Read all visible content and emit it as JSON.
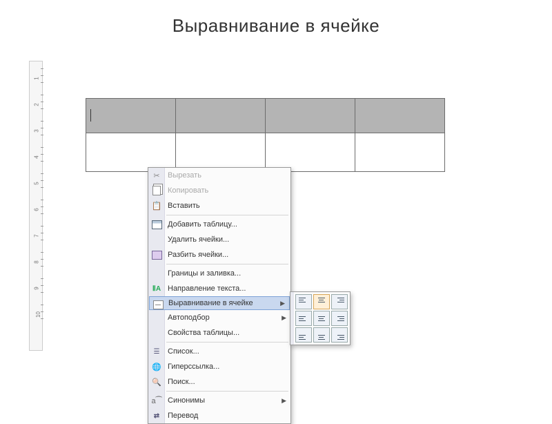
{
  "title": "Выравнивание в ячейке",
  "ruler": {
    "numbers": [
      1,
      2,
      3,
      4,
      5,
      6,
      7,
      8,
      9,
      10
    ]
  },
  "context_menu": {
    "items": [
      {
        "id": "cut",
        "label": "Вырезать",
        "icon": "cut",
        "disabled": true
      },
      {
        "id": "copy",
        "label": "Копировать",
        "icon": "copy",
        "disabled": true
      },
      {
        "id": "paste",
        "label": "Вставить",
        "icon": "paste",
        "disabled": false
      },
      {
        "sep": true
      },
      {
        "id": "insert-tbl",
        "label": "Добавить таблицу...",
        "icon": "addtbl",
        "disabled": false
      },
      {
        "id": "del-cells",
        "label": "Удалить ячейки...",
        "icon": "",
        "disabled": false
      },
      {
        "id": "split",
        "label": "Разбить ячейки...",
        "icon": "split",
        "disabled": false
      },
      {
        "sep": true
      },
      {
        "id": "borders",
        "label": "Границы и заливка...",
        "icon": "",
        "disabled": false
      },
      {
        "id": "text-dir",
        "label": "Направление текста...",
        "icon": "txtdir",
        "disabled": false
      },
      {
        "id": "cell-align",
        "label": "Выравнивание в ячейке",
        "icon": "align",
        "disabled": false,
        "submenu": true,
        "hover": true
      },
      {
        "id": "autofit",
        "label": "Автоподбор",
        "icon": "",
        "disabled": false,
        "submenu": true
      },
      {
        "id": "tbl-props",
        "label": "Свойства таблицы...",
        "icon": "",
        "disabled": false
      },
      {
        "sep": true
      },
      {
        "id": "list",
        "label": "Список...",
        "icon": "list",
        "disabled": false
      },
      {
        "id": "hyperlink",
        "label": "Гиперссылка...",
        "icon": "link",
        "disabled": false
      },
      {
        "id": "find",
        "label": "Поиск...",
        "icon": "find",
        "disabled": false
      },
      {
        "sep": true
      },
      {
        "id": "synonyms",
        "label": "Синонимы",
        "icon": "trans2",
        "disabled": false,
        "submenu": true
      },
      {
        "id": "translate",
        "label": "Перевод",
        "icon": "trans",
        "disabled": false
      }
    ]
  },
  "align_submenu": {
    "options": [
      {
        "id": "tl",
        "name": "align-top-left"
      },
      {
        "id": "tc",
        "name": "align-top-center",
        "selected": true
      },
      {
        "id": "tr",
        "name": "align-top-right"
      },
      {
        "id": "ml",
        "name": "align-middle-left"
      },
      {
        "id": "mc",
        "name": "align-middle-center"
      },
      {
        "id": "mr",
        "name": "align-middle-right"
      },
      {
        "id": "bl",
        "name": "align-bottom-left"
      },
      {
        "id": "bc",
        "name": "align-bottom-center"
      },
      {
        "id": "br",
        "name": "align-bottom-right"
      }
    ]
  },
  "table": {
    "cols": 4,
    "rows": 2
  }
}
